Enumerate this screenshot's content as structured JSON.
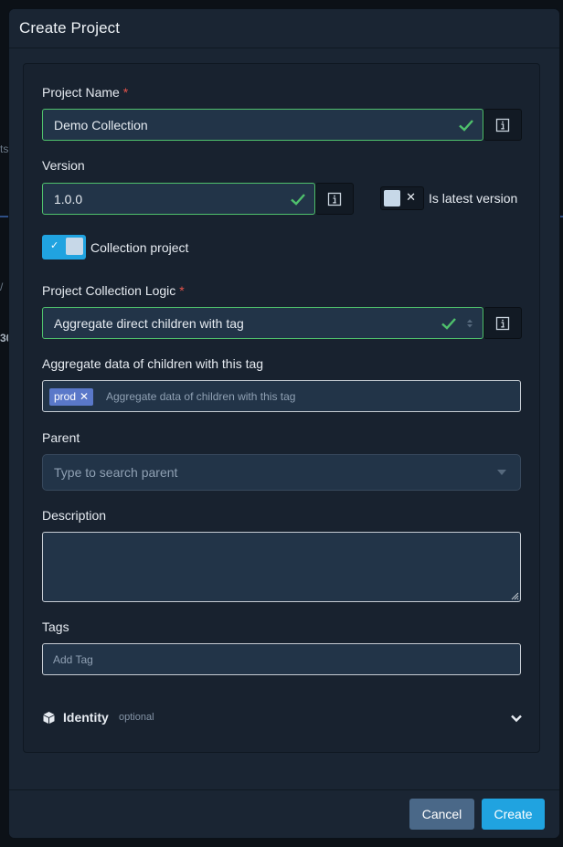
{
  "modal": {
    "title": "Create Project"
  },
  "form": {
    "project_name": {
      "label": "Project Name",
      "required_mark": "*",
      "value": "Demo Collection"
    },
    "version": {
      "label": "Version",
      "value": "1.0.0"
    },
    "is_latest_version": {
      "label": "Is latest version",
      "checked": false,
      "off_glyph": "✕"
    },
    "collection_project": {
      "label": "Collection project",
      "checked": true,
      "on_glyph": "✓"
    },
    "collection_logic": {
      "label": "Project Collection Logic",
      "required_mark": "*",
      "value": "Aggregate direct children with tag"
    },
    "aggregate_tag": {
      "label": "Aggregate data of children with this tag",
      "chip": "prod",
      "chip_remove": "✕",
      "placeholder": "Aggregate data of children with this tag"
    },
    "parent": {
      "label": "Parent",
      "placeholder": "Type to search parent"
    },
    "description": {
      "label": "Description",
      "value": ""
    },
    "tags": {
      "label": "Tags",
      "placeholder": "Add Tag"
    },
    "identity": {
      "title": "Identity",
      "hint": "optional"
    }
  },
  "footer": {
    "cancel_label": "Cancel",
    "create_label": "Create"
  },
  "background": {
    "frag_ts": "ts",
    "frag_slash": "/",
    "frag_30": "30"
  },
  "colors": {
    "accent": "#20a3e0",
    "valid": "#4fc16c",
    "required": "#e5534b",
    "chip": "#5a78c9",
    "cancel": "#4a6888"
  },
  "icons": {
    "info": "info-icon",
    "check": "check-icon",
    "select_arrows": "sort-arrows-icon",
    "dropdown": "caret-down-icon",
    "identity": "cube-icon",
    "expand": "chevron-down-icon"
  }
}
